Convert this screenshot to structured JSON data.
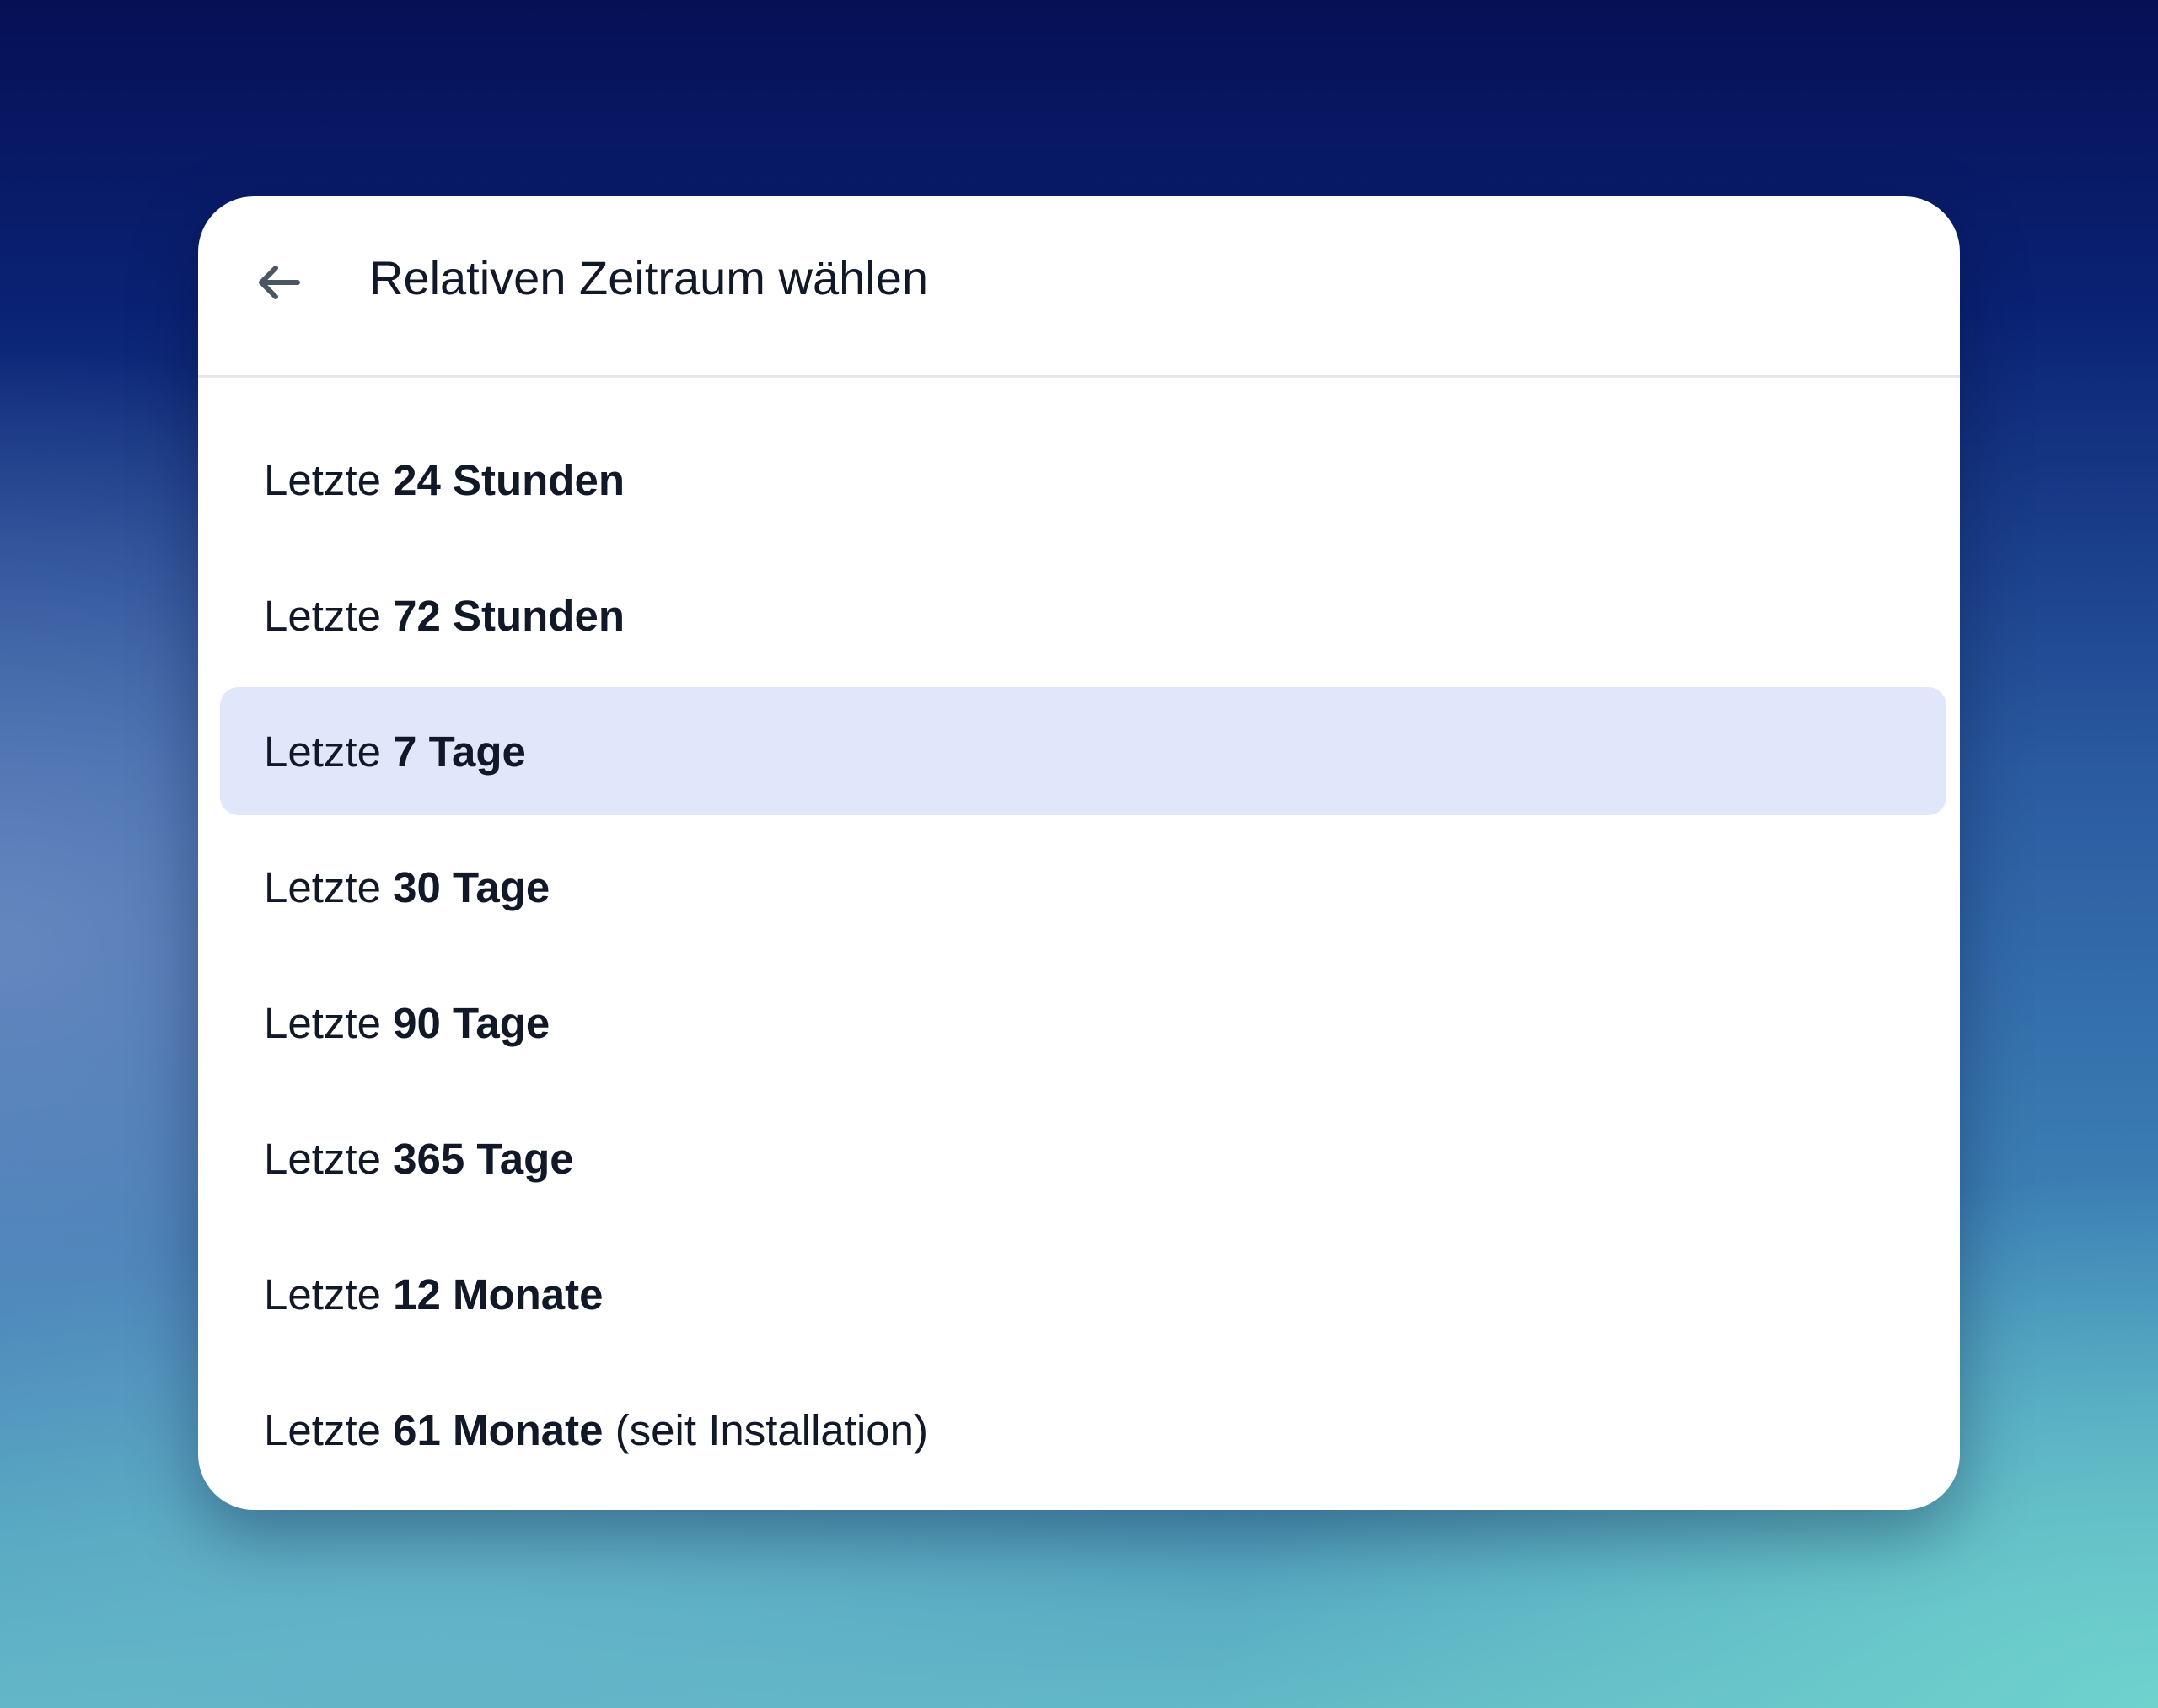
{
  "dialog": {
    "title": "Relativen Zeitraum wählen",
    "back_icon": "arrow-left-icon",
    "selected_index": 2,
    "highlight_color": "#e0e7fb",
    "items": [
      {
        "prefix": "Letzte",
        "bold": "24 Stunden",
        "suffix": ""
      },
      {
        "prefix": "Letzte",
        "bold": "72 Stunden",
        "suffix": ""
      },
      {
        "prefix": "Letzte",
        "bold": "7 Tage",
        "suffix": ""
      },
      {
        "prefix": "Letzte",
        "bold": "30 Tage",
        "suffix": ""
      },
      {
        "prefix": "Letzte",
        "bold": "90 Tage",
        "suffix": ""
      },
      {
        "prefix": "Letzte",
        "bold": "365 Tage",
        "suffix": ""
      },
      {
        "prefix": "Letzte",
        "bold": "12 Monate",
        "suffix": ""
      },
      {
        "prefix": "Letzte",
        "bold": "61 Monate",
        "suffix": "(seit Installation)"
      }
    ]
  }
}
